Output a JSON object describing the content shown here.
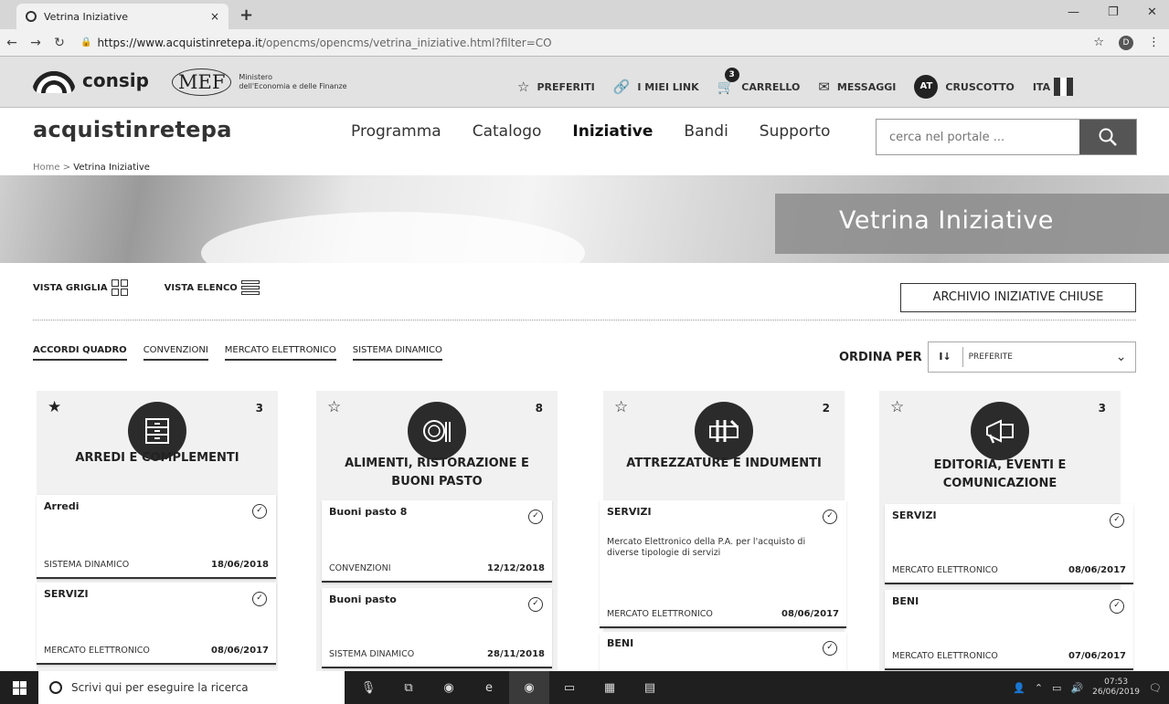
{
  "browser": {
    "tab_title": "Vetrina Iniziative",
    "tab_close": "×",
    "new_tab": "+",
    "url_host": "https://www.acquistinretepa.it",
    "url_path": "/opencms/opencms/vetrina_iniziative.html?filter=CO",
    "profile_initial": "D"
  },
  "utility": {
    "consip_name": "consip",
    "mef_mark": "MEF",
    "mef_line1": "Ministero",
    "mef_line2": "dell'Economia e delle Finanze",
    "preferiti": "PREFERITI",
    "miei_link": "I MIEI LINK",
    "cart_count": "3",
    "carrello": "CARRELLO",
    "messaggi": "MESSAGGI",
    "avatar": "AT",
    "cruscotto": "CRUSCOTTO",
    "lang": "ITA",
    "flag_colors": [
      "#333333",
      "#ffffff",
      "#333333"
    ]
  },
  "header": {
    "brand": "acquistinretepa",
    "nav": [
      "Programma",
      "Catalogo",
      "Iniziative",
      "Bandi",
      "Supporto"
    ],
    "search_placeholder": "cerca nel portale ...",
    "breadcrumb_home": "Home",
    "breadcrumb_sep": ">",
    "breadcrumb_current": "Vetrina Iniziative"
  },
  "hero": {
    "title": "Vetrina Iniziative"
  },
  "controls": {
    "vista_griglia": "VISTA GRIGLIA",
    "vista_elenco": "VISTA ELENCO",
    "archive": "ARCHIVIO INIZIATIVE CHIUSE",
    "filters": [
      "ACCORDI QUADRO",
      "CONVENZIONI",
      "MERCATO ELETTRONICO",
      "SISTEMA DINAMICO"
    ],
    "ordina_label": "ORDINA PER",
    "sort_icon": "I↓",
    "sort_value": "PREFERITE"
  },
  "categories": [
    {
      "name": "ARREDI E COMPLEMENTI",
      "count": "3",
      "starred": true,
      "icon": "drawer-icon",
      "cards": [
        {
          "title": "Arredi",
          "type": "SISTEMA DINAMICO",
          "date": "18/06/2018"
        },
        {
          "title": "SERVIZI",
          "type": "MERCATO ELETTRONICO",
          "date": "08/06/2017"
        }
      ]
    },
    {
      "name": "ALIMENTI, RISTORAZIONE E BUONI PASTO",
      "count": "8",
      "starred": false,
      "icon": "food-icon",
      "cards": [
        {
          "title": "Buoni pasto 8",
          "type": "CONVENZIONI",
          "date": "12/12/2018"
        },
        {
          "title": "Buoni pasto",
          "type": "SISTEMA DINAMICO",
          "date": "28/11/2018"
        }
      ]
    },
    {
      "name": "ATTREZZATURE E INDUMENTI",
      "count": "2",
      "starred": false,
      "icon": "tools-icon",
      "cards": [
        {
          "title": "SERVIZI",
          "desc": "Mercato Elettronico della P.A. per l'acquisto di diverse tipologie di servizi",
          "type": "MERCATO ELETTRONICO",
          "date": "08/06/2017"
        },
        {
          "title": "BENI"
        }
      ]
    },
    {
      "name": "EDITORIA, EVENTI E COMUNICAZIONE",
      "count": "3",
      "starred": false,
      "icon": "megaphone-icon",
      "cards": [
        {
          "title": "SERVIZI",
          "type": "MERCATO ELETTRONICO",
          "date": "08/06/2017"
        },
        {
          "title": "BENI",
          "type": "MERCATO ELETTRONICO",
          "date": "07/06/2017"
        }
      ]
    }
  ],
  "taskbar": {
    "search_text": "Scrivi qui per eseguire la ricerca",
    "time": "07:53",
    "date": "26/06/2019"
  }
}
